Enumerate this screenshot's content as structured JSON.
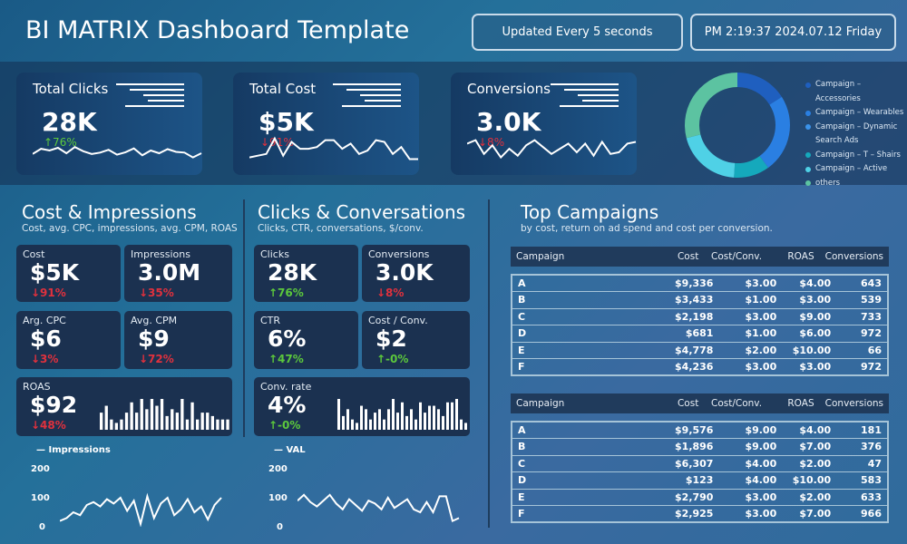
{
  "header": {
    "title": "BI MATRIX Dashboard Template",
    "update": "Updated Every 5 seconds",
    "datetime": "PM 2:19:37 2024.07.12 Friday"
  },
  "kpis": [
    {
      "label": "Total Clicks",
      "value": "28K",
      "change": "↑76%",
      "dir": "up",
      "spark": [
        40,
        55,
        50,
        58,
        42,
        60,
        48,
        40,
        44,
        52,
        38,
        45,
        56,
        36,
        50,
        42,
        54,
        46,
        44,
        30,
        42
      ]
    },
    {
      "label": "Total Cost",
      "value": "$5K",
      "change": "↓91%",
      "dir": "down",
      "spark": [
        30,
        35,
        40,
        85,
        35,
        75,
        55,
        55,
        60,
        80,
        80,
        55,
        70,
        40,
        50,
        80,
        75,
        40,
        60,
        25,
        25
      ]
    },
    {
      "label": "Conversions",
      "value": "3.0K",
      "change": "↓8%",
      "dir": "down",
      "spark": [
        70,
        80,
        40,
        65,
        30,
        55,
        35,
        65,
        80,
        60,
        40,
        55,
        70,
        45,
        70,
        35,
        75,
        40,
        45,
        70,
        75
      ]
    }
  ],
  "donut": {
    "segments": [
      {
        "label": "Campaign – Accessories",
        "value": 16,
        "color": "#1f5fbf"
      },
      {
        "label": "Campaign – Wearables",
        "value": 24,
        "color": "#2a7fe2"
      },
      {
        "label": "Campaign – Dynamic Search Ads",
        "value": 0.1,
        "color": "#3b93ea"
      },
      {
        "label": "Campaign – T – Shairs",
        "value": 11,
        "color": "#15a9bc"
      },
      {
        "label": "Campaign – Active",
        "value": 20,
        "color": "#4fd1e6"
      },
      {
        "label": "others",
        "value": 29,
        "color": "#5cc3a1"
      }
    ]
  },
  "cost_impressions": {
    "title": "Cost & Impressions",
    "subtitle": "Cost, avg. CPC, impressions, avg. CPM, ROAS",
    "cards": [
      {
        "label": "Cost",
        "value": "$5K",
        "change": "↓91%",
        "dir": "down"
      },
      {
        "label": "Impressions",
        "value": "3.0M",
        "change": "↓35%",
        "dir": "down"
      },
      {
        "label": "Arg. CPC",
        "value": "$6",
        "change": "↓3%",
        "dir": "down"
      },
      {
        "label": "Avg. CPM",
        "value": "$9",
        "change": "↓72%",
        "dir": "down"
      },
      {
        "label": "ROAS",
        "value": "$92",
        "change": "↓48%",
        "dir": "down",
        "bars": [
          5,
          7,
          3,
          2,
          3,
          5,
          8,
          5,
          9,
          6,
          9,
          7,
          9,
          4,
          6,
          5,
          9,
          3,
          8,
          3,
          5,
          5,
          4,
          3,
          3,
          3
        ]
      }
    ],
    "line": {
      "legend": "Impressions",
      "yticks": [
        "200",
        "100",
        "0"
      ],
      "ylim": [
        0,
        200
      ],
      "values": [
        20,
        30,
        50,
        40,
        75,
        85,
        70,
        95,
        80,
        100,
        55,
        90,
        10,
        105,
        30,
        80,
        100,
        40,
        60,
        95,
        50,
        70,
        25,
        75,
        100
      ]
    }
  },
  "clicks_conversations": {
    "title": "Clicks & Conversations",
    "subtitle": "Clicks, CTR, conversations, $/conv.",
    "cards": [
      {
        "label": "Clicks",
        "value": "28K",
        "change": "↑76%",
        "dir": "up"
      },
      {
        "label": "Conversions",
        "value": "3.0K",
        "change": "↓8%",
        "dir": "down"
      },
      {
        "label": "CTR",
        "value": "6%",
        "change": "↑47%",
        "dir": "up"
      },
      {
        "label": "Cost / Conv.",
        "value": "$2",
        "change": "↑-0%",
        "dir": "up"
      },
      {
        "label": "Conv. rate",
        "value": "4%",
        "change": "↑-0%",
        "dir": "up",
        "bars": [
          9,
          4,
          6,
          3,
          2,
          7,
          6,
          3,
          5,
          6,
          3,
          6,
          9,
          5,
          8,
          4,
          6,
          3,
          8,
          5,
          7,
          7,
          6,
          4,
          8,
          8,
          9,
          3,
          2
        ]
      }
    ],
    "line": {
      "legend": "VAL",
      "yticks": [
        "200",
        "100",
        "0"
      ],
      "ylim": [
        0,
        200
      ],
      "values": [
        90,
        110,
        85,
        70,
        90,
        110,
        80,
        60,
        95,
        75,
        55,
        90,
        80,
        60,
        100,
        65,
        80,
        95,
        60,
        50,
        85,
        50,
        105,
        105,
        20,
        30
      ]
    }
  },
  "top_campaigns": {
    "title": "Top Campaigns",
    "subtitle": "by cost, return on ad spend and cost per conversion.",
    "columns": [
      "Campaign",
      "Cost",
      "Cost/Conv.",
      "ROAS",
      "Conversions"
    ],
    "tables": [
      [
        [
          "A",
          "$9,336",
          "$3.00",
          "$4.00",
          "643"
        ],
        [
          "B",
          "$3,433",
          "$1.00",
          "$3.00",
          "539"
        ],
        [
          "C",
          "$2,198",
          "$3.00",
          "$9.00",
          "733"
        ],
        [
          "D",
          "$681",
          "$1.00",
          "$6.00",
          "972"
        ],
        [
          "E",
          "$4,778",
          "$2.00",
          "$10.00",
          "66"
        ],
        [
          "F",
          "$4,236",
          "$3.00",
          "$3.00",
          "972"
        ]
      ],
      [
        [
          "A",
          "$9,576",
          "$9.00",
          "$4.00",
          "181"
        ],
        [
          "B",
          "$1,896",
          "$9.00",
          "$7.00",
          "376"
        ],
        [
          "C",
          "$6,307",
          "$4.00",
          "$2.00",
          "47"
        ],
        [
          "D",
          "$123",
          "$4.00",
          "$10.00",
          "583"
        ],
        [
          "E",
          "$2,790",
          "$3.00",
          "$2.00",
          "633"
        ],
        [
          "F",
          "$2,925",
          "$3.00",
          "$7.00",
          "966"
        ]
      ]
    ]
  },
  "colors": {
    "up": "#5cc83c",
    "down": "#e0313d",
    "card": "#1b3150"
  }
}
